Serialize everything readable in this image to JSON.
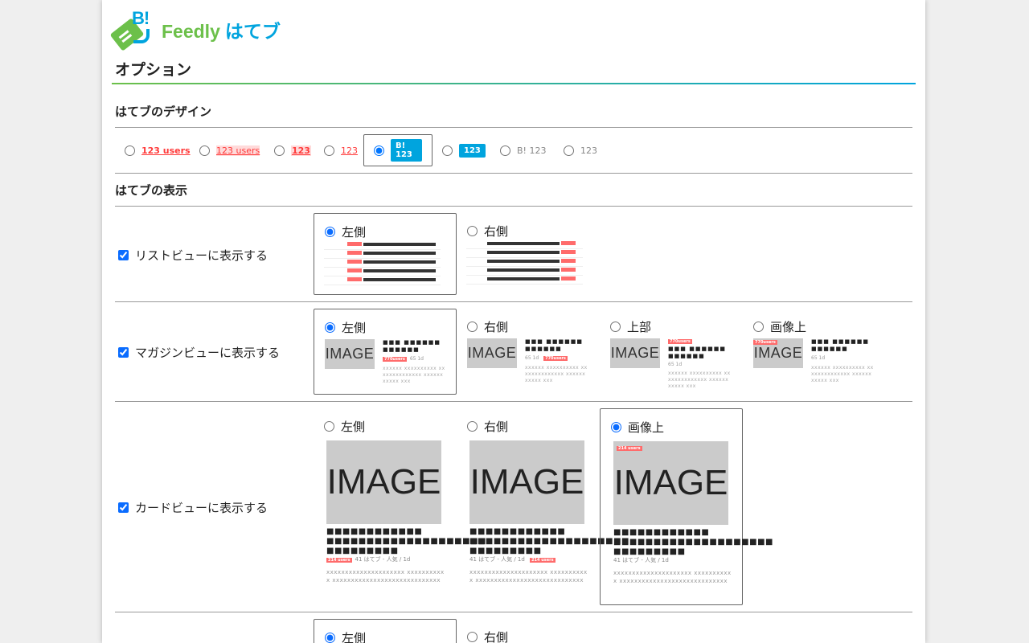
{
  "app": {
    "feedly": "Feedly",
    "hatebu": "はてブ",
    "logo_mark": "B!"
  },
  "page_title": "オプション",
  "sections": {
    "design": "はてブのデザイン",
    "display": "はてブの表示"
  },
  "designs": [
    {
      "text": "123 users",
      "style": "red-bold",
      "selected": false
    },
    {
      "text": "123 users",
      "style": "red-bg",
      "selected": false
    },
    {
      "text": "123",
      "style": "red-bold-bg",
      "selected": false
    },
    {
      "text": "123",
      "style": "red-thin",
      "selected": false
    },
    {
      "text": "B! 123",
      "style": "blue-badge",
      "selected": true
    },
    {
      "text": "123",
      "style": "blue-box",
      "selected": false
    },
    {
      "text": "B! 123",
      "style": "gray",
      "selected": false
    },
    {
      "text": "123",
      "style": "gray",
      "selected": false
    }
  ],
  "list_view": {
    "label": "リストビューに表示する",
    "checked": true,
    "options": [
      "左側",
      "右側"
    ],
    "selected": "左側"
  },
  "magazine_view": {
    "label": "マガジンビューに表示する",
    "checked": true,
    "options": [
      "左側",
      "右側",
      "上部",
      "画像上"
    ],
    "selected": "左側"
  },
  "card_view": {
    "label": "カードビューに表示する",
    "checked": true,
    "options": [
      "左側",
      "右側",
      "画像上"
    ],
    "selected": "画像上"
  },
  "next_view": {
    "options": [
      "左側",
      "右側"
    ],
    "selected": "左側"
  },
  "preview": {
    "image_text": "IMAGE",
    "users_badge": "770users",
    "card_badge": "214 users",
    "card_meta": "41  はてブ - 人気 / 1d",
    "mag_meta": "65  1d",
    "title_mask": "■■■ ■■■■■■ ■■■■■■",
    "card_title_mask": "■■■■■■■■■■■■ ■■■■■■■■■■■■■■■■■■■■ ■■■■■■■■■",
    "desc_mask": "xxxxxx xxxxxxxxxx xx xxxxxxxxxxxx xxxxxx xxxxx xxx",
    "card_desc_mask": "xxxxxxxxxxxxxxxxxxxxx xxxxxxxxxxx xxxxxxxxxxxxxxxxxxxxxxxxxxxxx"
  }
}
